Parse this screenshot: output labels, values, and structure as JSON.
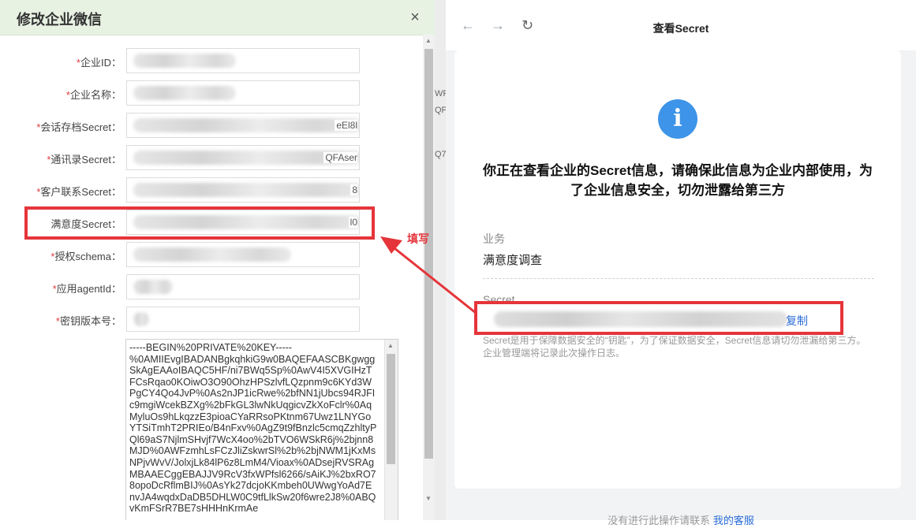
{
  "modal": {
    "title": "修改企业微信",
    "close_glyph": "×",
    "fields": [
      {
        "required": true,
        "label": "企业ID：",
        "tail": ""
      },
      {
        "required": true,
        "label": "企业名称：",
        "tail": ""
      },
      {
        "required": true,
        "label": "会话存档Secret：",
        "tail": "eEl8l"
      },
      {
        "required": true,
        "label": "通讯录Secret：",
        "tail": "QFAser"
      },
      {
        "required": true,
        "label": "客户联系Secret：",
        "tail": "8"
      },
      {
        "required": false,
        "label": "满意度Secret：",
        "tail": "l0"
      },
      {
        "required": true,
        "label": "授权schema：",
        "tail": ""
      },
      {
        "required": true,
        "label": "应用agentId：",
        "tail": ""
      },
      {
        "required": true,
        "label": "密钥版本号：",
        "tail": ""
      }
    ],
    "private_key_text": "-----BEGIN%20PRIVATE%20KEY-----\n%0AMIIEvgIBADANBgkqhkiG9w0BAQEFAASCBKgwgg\nSkAgEAAoIBAQC5HF/ni7BWq5Sp%0AwV4I5XVGIHzT\nFCsRqao0KOiwO3O90OhzHPSzlvfLQzpnm9c6KYd3W\nPgCY4Qo4JvP%0As2nJP1icRwe%2bfNN1jUbcs94RJFI\nc9mgiWcekBZXg%2bFkGL3lwNkUqgicvZkXoFclr%0Aq\nMyluOs9hLkqzzE3pioaCYaRRsoPKtnm67Uwz1LNYGo\nYTSiTmhT2PRIEo/B4nFxv%0AgZ9t9fBnzlc5cmqZzhltyP\nQl69aS7NjlmSHvjf7WcX4oo%2bTVO6WSkR6j%2bjnn8\nMJD%0AWFzmhLsFCzJliZskwrSl%2b%2bjNWM1jKxMs\nNPjvWvV/JolxjLk84lP6z8LmM4/Vioax%0ADsejRVSRAg\nMBAAECggEBAJJV9RcV3fxWPfsl6266/sAiKJ%2bxRO7\n8opoDcRflmBIJ%0AsYk27dcjoKKmbeh0UWwgYoAd7E\nnvJA4wqdxDaDB5DHLW0C9tfLlkSw20f6wre2J8%0ABQ\nvKmFSrR7BE7sHHHnKrmAe"
  },
  "gap": {
    "t1": "WF",
    "t2": "QP",
    "t3": "Q7"
  },
  "browser": {
    "nav_back": "←",
    "nav_forward": "→",
    "nav_reload": "↻",
    "title": "查看Secret",
    "info_glyph": "i",
    "warning": "你正在查看企业的Secret信息，请确保此信息为企业内部使用，为了企业信息安全，切勿泄露给第三方",
    "business_label": "业务",
    "business_value": "满意度调查",
    "secret_label": "Secret",
    "copy_label": "复制",
    "note_line1": "Secret是用于保障数据安全的“钥匙”，为了保证数据安全，Secret信息请切勿泄漏给第三方。",
    "note_line2": "企业管理端将记录此次操作日志。",
    "footer_text": "没有进行此操作请联系",
    "footer_link": "我的客服"
  },
  "annotation": {
    "text": "填写",
    "color": "#e5353a"
  }
}
